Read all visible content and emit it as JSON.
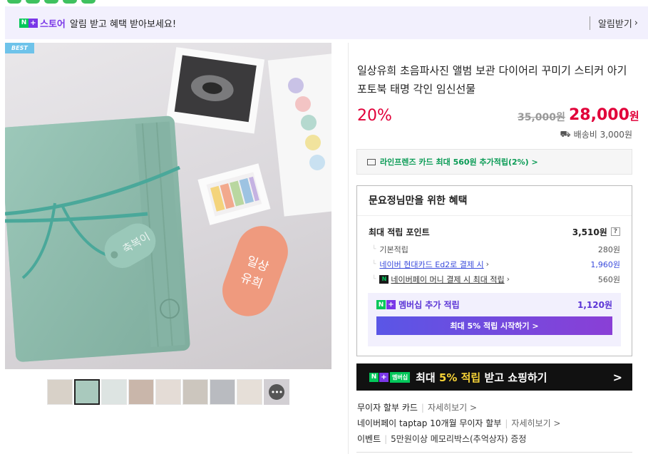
{
  "notice": {
    "badge_n": "N",
    "badge_plus": "+",
    "store_label": "스토어",
    "text": "알림 받고 혜택 받아보세요!",
    "link": "알림받기"
  },
  "image": {
    "best_tag": "BEST"
  },
  "thumbnails": [
    "thumb-1",
    "thumb-2",
    "thumb-3",
    "thumb-4",
    "thumb-5",
    "thumb-6",
    "thumb-7",
    "thumb-8",
    "thumb-9"
  ],
  "thumbnail_more": "•••",
  "product": {
    "title": "일상유희 초음파사진 앨범 보관 다이어리 꾸미기 스티커 아기 포토북 태명 각인 임신선물",
    "discount": "20%",
    "original_price": "35,000원",
    "sale_price": "28,000",
    "sale_unit": "원",
    "shipping": "배송비 3,000원"
  },
  "card_offer": "라인프렌즈 카드 최대 560원 추가적립(2%) >",
  "benefits": {
    "title": "문요정님만을 위한 혜택",
    "max_points_label": "최대 적립 포인트",
    "max_points_value": "3,510원",
    "help": "?",
    "rows": [
      {
        "label": "기본적립",
        "value": "280원"
      },
      {
        "label": "네이버 현대카드 Ed2로 결제 시",
        "value": "1,960원"
      },
      {
        "label": "네이버페이 머니 결제 시 최대 적립",
        "value": "560원"
      }
    ],
    "np_badge": "N",
    "membership_label": "멤버십 추가 적립",
    "membership_value": "1,120원",
    "membership_button": "최대 5% 적립 시작하기 >"
  },
  "banner": {
    "tag": "멤버십",
    "text_pre": "최대 ",
    "text_hl": "5% 적립",
    "text_post": " 받고 쇼핑하기",
    "arrow": ">"
  },
  "info": [
    {
      "label": "무이자 할부 카드",
      "more": "자세히보기 >"
    },
    {
      "label": "네이버페이 taptap 10개월 무이자 할부",
      "more": "자세히보기 >"
    },
    {
      "label": "이벤트",
      "more": "5만원이상 메모리박스(추억상자) 증정"
    }
  ],
  "colors": {
    "accent_red": "#e10039",
    "naver_green": "#03c75a",
    "membership_purple": "#5b35d6"
  }
}
